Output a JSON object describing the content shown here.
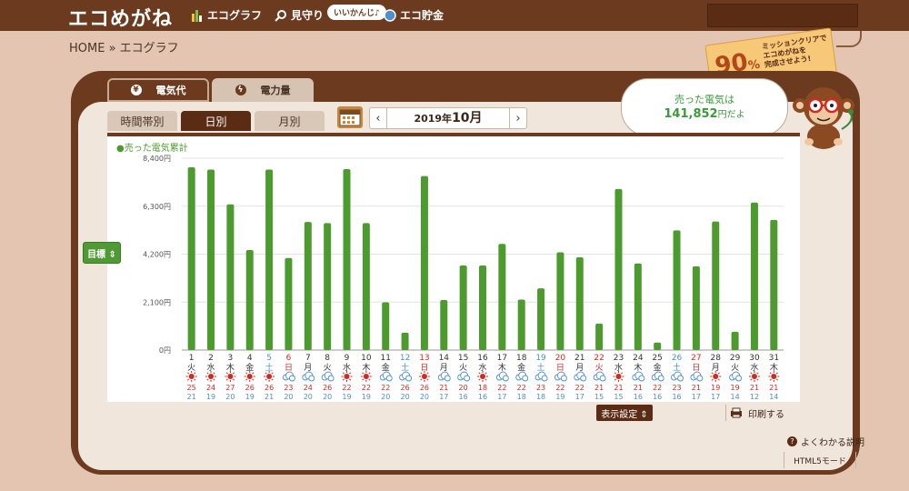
{
  "app": {
    "logo": "エコめがね"
  },
  "nav": [
    {
      "label": "エコグラフ",
      "icon": "bar-chart-icon"
    },
    {
      "label": "見守り",
      "icon": "magnifier-icon"
    },
    {
      "label": "エコ貯金",
      "icon": "coin-icon"
    }
  ],
  "nav_pill": "いいかんじ♪",
  "breadcrumb": "HOME » エコグラフ",
  "mission": {
    "percent": "90",
    "unit": "%",
    "text": "ミッションクリアで\nエコめがねを\n完成させよう!"
  },
  "tabs": [
    {
      "label": "電気代",
      "icon": "yen-icon",
      "active": true
    },
    {
      "label": "電力量",
      "icon": "lightning-icon",
      "active": false
    }
  ],
  "subtabs": [
    {
      "label": "時間帯別",
      "active": false
    },
    {
      "label": "日別",
      "active": true
    },
    {
      "label": "月別",
      "active": false
    }
  ],
  "month": {
    "year_label": "2019年",
    "month_label": "10月",
    "prev": "‹",
    "next": "›"
  },
  "speech": {
    "line1": "売った電気は",
    "amount": "141,852",
    "suffix": "円だよ"
  },
  "goal_button": "目標 ⇕",
  "display_setting": "表示設定 ⇕",
  "print": "印刷する",
  "help": "よくわかる説明",
  "html5": "HTML5モード",
  "colors": {
    "bar": "#4d9b2e",
    "brown": "#6b3a1f",
    "sun": "#d6281f",
    "cloud": "#4d8fcf",
    "sat": "#4d8fcf",
    "sun_day": "#d6281f"
  },
  "chart_data": {
    "type": "bar",
    "series_label": "●売った電気累計",
    "ylim": [
      0,
      8400
    ],
    "yticks": [
      "0円",
      "2,100円",
      "4,200円",
      "6,300円",
      "8,400円"
    ],
    "days": [
      "1",
      "2",
      "3",
      "4",
      "5",
      "6",
      "7",
      "8",
      "9",
      "10",
      "11",
      "12",
      "13",
      "14",
      "15",
      "16",
      "17",
      "18",
      "19",
      "20",
      "21",
      "22",
      "23",
      "24",
      "25",
      "26",
      "27",
      "28",
      "29",
      "30",
      "31"
    ],
    "weekdays": [
      "火",
      "水",
      "木",
      "金",
      "土",
      "日",
      "月",
      "火",
      "水",
      "木",
      "金",
      "土",
      "日",
      "月",
      "火",
      "水",
      "木",
      "金",
      "土",
      "日",
      "月",
      "火",
      "水",
      "木",
      "金",
      "土",
      "日",
      "月",
      "火",
      "水",
      "木"
    ],
    "values": [
      8000,
      7900,
      6380,
      4380,
      7900,
      4030,
      5610,
      5560,
      7920,
      5560,
      2090,
      760,
      7620,
      2190,
      3700,
      3700,
      4650,
      2210,
      2700,
      4280,
      4060,
      1160,
      7050,
      3790,
      330,
      5240,
      3670,
      5630,
      800,
      6460,
      5700
    ],
    "weather": [
      "sun",
      "sun",
      "sun",
      "sun",
      "sun",
      "cloud",
      "cloud",
      "cloud",
      "sun",
      "sun",
      "cloud",
      "cloud",
      "sun",
      "cloud",
      "cloud",
      "sun",
      "cloud",
      "cloud",
      "cloud",
      "cloud",
      "cloud",
      "cloud",
      "sun",
      "cloud",
      "cloud",
      "cloud",
      "cloud",
      "sun",
      "cloud",
      "sun",
      "sun"
    ],
    "high": [
      "25",
      "24",
      "27",
      "26",
      "26",
      "23",
      "24",
      "26",
      "22",
      "22",
      "22",
      "26",
      "26",
      "21",
      "20",
      "18",
      "22",
      "22",
      "23",
      "22",
      "22",
      "21",
      "21",
      "21",
      "22",
      "23",
      "21",
      "19",
      "19",
      "21",
      "21"
    ],
    "low": [
      "21",
      "19",
      "20",
      "19",
      "21",
      "20",
      "20",
      "20",
      "19",
      "19",
      "20",
      "20",
      "20",
      "17",
      "16",
      "16",
      "17",
      "18",
      "18",
      "19",
      "17",
      "15",
      "15",
      "16",
      "16",
      "16",
      "17",
      "17",
      "14",
      "12",
      "14"
    ]
  }
}
